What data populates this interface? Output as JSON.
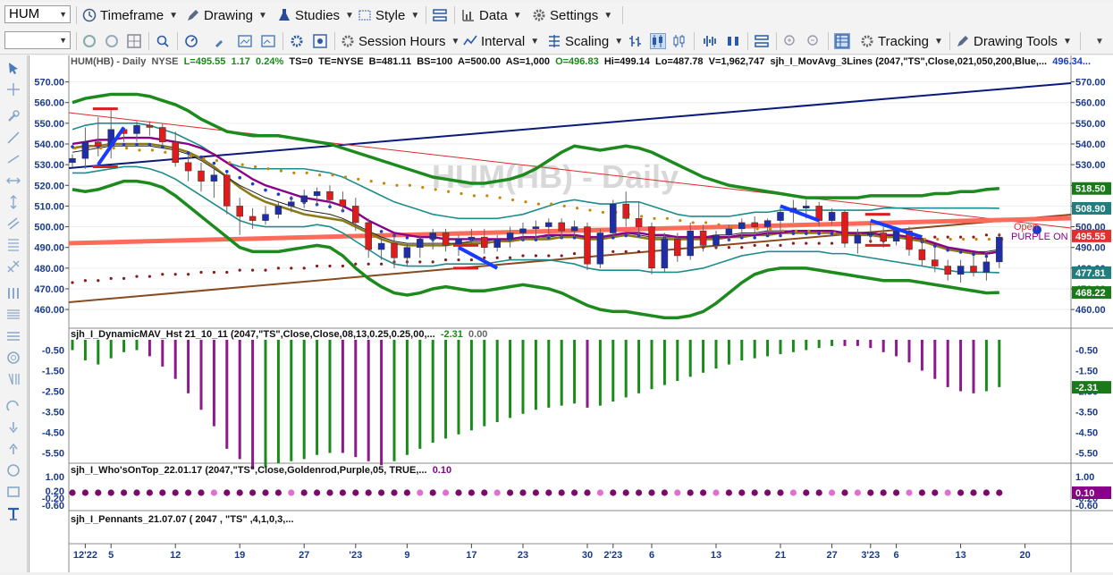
{
  "symbol": "HUM",
  "toolbar1": {
    "timeframe": "Timeframe",
    "drawing": "Drawing",
    "studies": "Studies",
    "style": "Style",
    "data": "Data",
    "settings": "Settings"
  },
  "toolbar2": {
    "session_hours": "Session Hours",
    "interval": "Interval",
    "scaling": "Scaling",
    "tracking": "Tracking",
    "drawing_tools": "Drawing Tools"
  },
  "header": {
    "symbol_label": "HUM(HB) - Daily",
    "exchange": "NYSE",
    "last": "L=495.55",
    "change": "1.17",
    "change_pct": "0.24%",
    "ts": "TS=0",
    "te": "TE=NYSE",
    "bid": "B=481.11",
    "bs": "BS=100",
    "ask": "A=500.00",
    "as": "AS=1,000",
    "open": "O=496.83",
    "hi": "Hi=499.14",
    "lo": "Lo=487.78",
    "vol": "V=1,962,747",
    "study": "sjh_I_MovAvg_3Lines (2047,\"TS\",Close,021,050,200,Blue,...",
    "study_value": "496.34..."
  },
  "watermark": "HUM(HB) - Daily",
  "annotations": {
    "open_label": "Open",
    "purple_on": "PURPLE ON"
  },
  "price_axis": {
    "ticks": [
      "570.00",
      "560.00",
      "550.00",
      "540.00",
      "530.00",
      "520.00",
      "510.00",
      "500.00",
      "490.00",
      "480.00",
      "470.00",
      "460.00"
    ],
    "tick_values": [
      570,
      560,
      550,
      540,
      530,
      520,
      510,
      500,
      490,
      480,
      470,
      460
    ],
    "badges": [
      {
        "text": "518.50",
        "color": "#1a7a1a",
        "value": 518.5
      },
      {
        "text": "508.90",
        "color": "#1f7f7f",
        "value": 508.9
      },
      {
        "text": "495.55",
        "color": "#e03030",
        "value": 495.55
      },
      {
        "text": "477.81",
        "color": "#1f7f7f",
        "value": 477.81
      },
      {
        "text": "468.22",
        "color": "#1a7a1a",
        "value": 468.22
      }
    ]
  },
  "pane2": {
    "title": "sjh_I_DynamicMAV_Hst 21_10_11 (2047,\"TS\",Close,Close,08,13,0.25,0.25,00,...",
    "val1": "-2.31",
    "val2": "0.00",
    "ticks": [
      "-0.50",
      "-1.50",
      "-2.50",
      "-3.50",
      "-4.50",
      "-5.50"
    ],
    "tick_values": [
      -0.5,
      -1.5,
      -2.5,
      -3.5,
      -4.5,
      -5.5
    ],
    "badge": "-2.31",
    "badge_value": -2.31
  },
  "pane3": {
    "title": "sjh_I_Who'sOnTop_22.01.17 (2047,\"TS\",Close,Goldenrod,Purple,05, TRUE,...",
    "val": "0.10",
    "ticks": [
      "1.00",
      "0.20",
      "-0.20",
      "-0.60"
    ],
    "tick_values": [
      1.0,
      0.2,
      -0.2,
      -0.6
    ],
    "badge": "0.10",
    "badge_value": 0.1
  },
  "pane4": {
    "title": "sjh_I_Pennants_21.07.07 ( 2047 , \"TS\" ,4,1,0,3,..."
  },
  "date_axis": [
    {
      "label": "12'22",
      "bar": 1
    },
    {
      "label": "5",
      "bar": 3
    },
    {
      "label": "12",
      "bar": 8
    },
    {
      "label": "19",
      "bar": 13
    },
    {
      "label": "27",
      "bar": 18
    },
    {
      "label": "'23",
      "bar": 22
    },
    {
      "label": "9",
      "bar": 26
    },
    {
      "label": "17",
      "bar": 31
    },
    {
      "label": "23",
      "bar": 35
    },
    {
      "label": "30",
      "bar": 40
    },
    {
      "label": "2'23",
      "bar": 42
    },
    {
      "label": "6",
      "bar": 45
    },
    {
      "label": "13",
      "bar": 50
    },
    {
      "label": "21",
      "bar": 55
    },
    {
      "label": "27",
      "bar": 59
    },
    {
      "label": "3'23",
      "bar": 62
    },
    {
      "label": "6",
      "bar": 64
    },
    {
      "label": "13",
      "bar": 69
    },
    {
      "label": "20",
      "bar": 74
    }
  ],
  "chart_data": {
    "type": "candlestick",
    "ylim": [
      454,
      575
    ],
    "candles": [
      [
        531,
        535,
        529,
        533
      ],
      [
        533,
        548,
        528,
        541
      ],
      [
        541,
        553,
        534,
        539
      ],
      [
        539,
        557,
        533,
        547
      ],
      [
        547,
        548,
        541,
        545
      ],
      [
        545,
        551,
        541,
        549
      ],
      [
        549,
        551,
        544,
        548
      ],
      [
        548,
        550,
        539,
        541
      ],
      [
        541,
        546,
        529,
        531
      ],
      [
        531,
        535,
        522,
        527
      ],
      [
        527,
        531,
        517,
        522
      ],
      [
        522,
        529,
        514,
        525
      ],
      [
        525,
        526,
        506,
        510
      ],
      [
        510,
        514,
        496,
        505
      ],
      [
        505,
        509,
        499,
        503
      ],
      [
        503,
        510,
        501,
        506
      ],
      [
        506,
        512,
        504,
        510
      ],
      [
        510,
        515,
        507,
        512
      ],
      [
        512,
        518,
        509,
        515
      ],
      [
        515,
        519,
        510,
        517
      ],
      [
        517,
        520,
        510,
        513
      ],
      [
        513,
        517,
        507,
        510
      ],
      [
        510,
        514,
        498,
        502
      ],
      [
        502,
        504,
        485,
        489
      ],
      [
        489,
        495,
        484,
        492
      ],
      [
        492,
        496,
        480,
        485
      ],
      [
        485,
        492,
        481,
        490
      ],
      [
        490,
        496,
        485,
        494
      ],
      [
        494,
        499,
        489,
        497
      ],
      [
        497,
        499,
        488,
        491
      ],
      [
        491,
        496,
        486,
        494
      ],
      [
        494,
        499,
        491,
        495
      ],
      [
        495,
        499,
        487,
        490
      ],
      [
        490,
        496,
        488,
        494
      ],
      [
        494,
        500,
        490,
        497
      ],
      [
        497,
        502,
        493,
        499
      ],
      [
        499,
        503,
        494,
        500
      ],
      [
        500,
        504,
        495,
        502
      ],
      [
        502,
        504,
        494,
        498
      ],
      [
        498,
        503,
        495,
        500
      ],
      [
        500,
        502,
        479,
        482
      ],
      [
        482,
        499,
        480,
        497
      ],
      [
        497,
        513,
        495,
        511
      ],
      [
        511,
        517,
        500,
        504
      ],
      [
        504,
        512,
        496,
        500
      ],
      [
        500,
        502,
        477,
        480
      ],
      [
        480,
        497,
        478,
        494
      ],
      [
        494,
        497,
        483,
        486
      ],
      [
        486,
        502,
        484,
        498
      ],
      [
        498,
        501,
        488,
        491
      ],
      [
        491,
        498,
        489,
        496
      ],
      [
        496,
        501,
        493,
        499
      ],
      [
        499,
        504,
        495,
        502
      ],
      [
        502,
        505,
        497,
        500
      ],
      [
        500,
        504,
        496,
        503
      ],
      [
        503,
        510,
        498,
        507
      ],
      [
        507,
        513,
        502,
        509
      ],
      [
        509,
        513,
        504,
        510
      ],
      [
        510,
        512,
        500,
        503
      ],
      [
        503,
        509,
        501,
        507
      ],
      [
        507,
        508,
        490,
        492
      ],
      [
        492,
        499,
        487,
        496
      ],
      [
        496,
        502,
        492,
        497
      ],
      [
        497,
        500,
        490,
        493
      ],
      [
        493,
        500,
        491,
        498
      ],
      [
        498,
        500,
        486,
        489
      ],
      [
        489,
        494,
        481,
        484
      ],
      [
        484,
        490,
        478,
        481
      ],
      [
        481,
        484,
        474,
        477
      ],
      [
        477,
        484,
        473,
        481
      ],
      [
        481,
        486,
        476,
        478
      ],
      [
        478,
        485,
        474,
        483
      ],
      [
        483,
        497,
        480,
        495
      ]
    ],
    "ma_purple": [
      540,
      541,
      542,
      542,
      543,
      543,
      543,
      542,
      541,
      540,
      538,
      535,
      531,
      527,
      523,
      520,
      518,
      516,
      514,
      513,
      512,
      510,
      507,
      503,
      500,
      497,
      496,
      495,
      495,
      494,
      494,
      494,
      494,
      494,
      494,
      495,
      495,
      496,
      496,
      496,
      495,
      495,
      496,
      497,
      497,
      496,
      496,
      495,
      495,
      495,
      495,
      495,
      496,
      496,
      497,
      497,
      498,
      498,
      498,
      498,
      497,
      497,
      497,
      496,
      496,
      495,
      494,
      492,
      490,
      489,
      488,
      487,
      488
    ],
    "ma_olive": [
      538,
      539,
      539,
      540,
      540,
      540,
      540,
      539,
      538,
      536,
      533,
      529,
      524,
      519,
      515,
      512,
      510,
      508,
      506,
      505,
      504,
      503,
      500,
      497,
      494,
      492,
      491,
      491,
      491,
      491,
      492,
      492,
      492,
      493,
      493,
      494,
      494,
      494,
      495,
      495,
      494,
      494,
      495,
      496,
      495,
      494,
      494,
      494,
      494,
      494,
      494,
      495,
      495,
      496,
      496,
      497,
      497,
      497,
      497,
      497,
      496,
      496,
      496,
      495,
      495,
      494,
      493,
      491,
      489,
      488,
      487,
      487,
      488
    ],
    "ma_black": [
      536,
      537,
      538,
      539,
      539,
      539,
      539,
      538,
      537,
      535,
      532,
      528,
      524,
      520,
      517,
      514,
      512,
      510,
      508,
      507,
      506,
      504,
      501,
      498,
      495,
      493,
      492,
      492,
      492,
      492,
      492,
      493,
      493,
      494,
      494,
      495,
      495,
      495,
      496,
      496,
      495,
      495,
      496,
      497,
      496,
      495,
      495,
      495,
      495,
      495,
      496,
      496,
      497,
      497,
      498,
      498,
      498,
      498,
      498,
      498,
      497,
      497,
      497,
      496,
      496,
      495,
      494,
      492,
      490,
      489,
      488,
      488,
      489
    ],
    "bb_upper": [
      560,
      562,
      563,
      564,
      564,
      564,
      563,
      561,
      559,
      556,
      552,
      549,
      546,
      545,
      544,
      544,
      544,
      543,
      542,
      541,
      540,
      538,
      536,
      534,
      532,
      530,
      528,
      526,
      524,
      523,
      522,
      521,
      521,
      522,
      523,
      525,
      528,
      532,
      536,
      539,
      538,
      537,
      538,
      539,
      538,
      536,
      533,
      530,
      527,
      524,
      522,
      520,
      519,
      518,
      517,
      516,
      515,
      514,
      514,
      514,
      514,
      514,
      515,
      515,
      515,
      515,
      515,
      516,
      516,
      517,
      517,
      518,
      518.5
    ],
    "bb_lower": [
      518,
      517,
      518,
      520,
      522,
      522,
      521,
      519,
      515,
      510,
      505,
      500,
      495,
      490,
      488,
      488,
      488,
      489,
      490,
      491,
      490,
      486,
      480,
      475,
      471,
      468,
      467,
      468,
      470,
      471,
      470,
      469,
      469,
      470,
      471,
      472,
      471,
      470,
      468,
      465,
      462,
      460,
      459,
      459,
      458,
      457,
      456,
      456,
      457,
      459,
      463,
      468,
      473,
      477,
      479,
      480,
      480,
      480,
      479,
      478,
      477,
      476,
      475,
      474,
      474,
      474,
      473,
      472,
      471,
      470,
      469,
      468,
      468.2
    ],
    "kc_upper": [
      547,
      549,
      550,
      550,
      550,
      550,
      549,
      547,
      545,
      542,
      539,
      535,
      531,
      529,
      528,
      528,
      528,
      528,
      528,
      527,
      526,
      524,
      521,
      518,
      515,
      512,
      510,
      508,
      506,
      505,
      504,
      504,
      504,
      504,
      505,
      506,
      508,
      510,
      512,
      513,
      512,
      511,
      511,
      512,
      512,
      510,
      508,
      506,
      505,
      505,
      505,
      505,
      506,
      507,
      507,
      508,
      508,
      508,
      508,
      508,
      508,
      508,
      508,
      509,
      509,
      509,
      509,
      509,
      509,
      509,
      509,
      509,
      508.9
    ],
    "kc_lower": [
      526,
      526,
      527,
      528,
      529,
      529,
      528,
      526,
      523,
      519,
      515,
      511,
      507,
      503,
      501,
      500,
      500,
      500,
      500,
      501,
      500,
      497,
      493,
      489,
      485,
      482,
      481,
      481,
      481,
      482,
      482,
      482,
      482,
      483,
      484,
      484,
      484,
      484,
      483,
      482,
      480,
      479,
      479,
      479,
      479,
      478,
      478,
      478,
      479,
      480,
      482,
      484,
      486,
      487,
      488,
      488,
      488,
      488,
      488,
      487,
      487,
      486,
      485,
      484,
      483,
      482,
      481,
      480,
      479,
      478,
      478,
      478,
      477.8
    ],
    "dots_gold": [
      538,
      538,
      538,
      538,
      538,
      537,
      537,
      536,
      535,
      534,
      533,
      532,
      531,
      530,
      529,
      528,
      527,
      526,
      526,
      525,
      525,
      524,
      523,
      522,
      521,
      520,
      520,
      519,
      518,
      517,
      516,
      515,
      515,
      514,
      513,
      512,
      511,
      511,
      510,
      509,
      508,
      507,
      507,
      506,
      505,
      504,
      504,
      503,
      502,
      502,
      501,
      500,
      500,
      499,
      499,
      498,
      498,
      498,
      497,
      497,
      496,
      496,
      496,
      495,
      495,
      495,
      494,
      494,
      494,
      494,
      494,
      494,
      494
    ],
    "dots_blue": [
      540,
      540,
      540,
      541,
      541,
      541,
      541,
      540,
      539,
      537,
      535,
      532,
      528,
      525,
      522,
      519,
      517,
      515,
      513,
      512,
      511,
      509,
      506,
      502,
      499,
      497,
      496,
      495,
      495,
      495,
      495,
      495,
      494,
      494,
      495,
      495,
      495,
      496,
      496,
      496,
      495,
      495,
      496,
      497,
      497,
      496,
      496,
      495,
      495,
      495,
      495,
      495,
      496,
      496,
      497,
      497,
      498,
      498,
      498,
      498,
      497,
      497,
      497,
      496,
      496,
      495,
      494,
      492,
      490,
      489,
      488,
      487,
      488
    ],
    "dots_maroon": [
      473,
      474,
      474,
      475,
      475,
      476,
      476,
      477,
      477,
      477,
      478,
      478,
      478,
      479,
      479,
      479,
      480,
      480,
      480,
      481,
      481,
      481,
      482,
      482,
      482,
      483,
      483,
      483,
      483,
      484,
      484,
      484,
      485,
      485,
      485,
      486,
      486,
      486,
      486,
      487,
      487,
      487,
      488,
      488,
      488,
      488,
      489,
      489,
      489,
      490,
      490,
      490,
      490,
      491,
      491,
      491,
      492,
      492,
      492,
      492,
      493,
      493,
      493,
      493,
      494,
      494,
      494,
      495,
      495,
      495,
      495,
      496,
      496
    ],
    "histogram": [
      -0.5,
      -1.0,
      -1.2,
      -0.9,
      -0.6,
      -0.5,
      -0.8,
      -1.3,
      -1.9,
      -2.6,
      -3.4,
      -4.2,
      -5.3,
      -5.8,
      -6.3,
      -6.2,
      -6.0,
      -5.9,
      -5.8,
      -5.6,
      -5.5,
      -5.5,
      -5.7,
      -5.9,
      -6.1,
      -5.9,
      -5.6,
      -5.3,
      -5.0,
      -4.8,
      -4.6,
      -4.4,
      -4.2,
      -4.0,
      -3.8,
      -3.6,
      -3.4,
      -3.3,
      -3.2,
      -3.1,
      -3.3,
      -3.2,
      -3.0,
      -2.8,
      -2.6,
      -2.4,
      -2.2,
      -2.0,
      -1.8,
      -1.6,
      -1.4,
      -1.2,
      -1.0,
      -0.9,
      -0.8,
      -0.7,
      -0.6,
      -0.5,
      -0.4,
      -0.3,
      -0.3,
      -0.3,
      -0.4,
      -0.6,
      -0.8,
      -1.1,
      -1.5,
      -1.9,
      -2.3,
      -2.5,
      -2.6,
      -2.5,
      -2.3
    ],
    "hist_colors": [
      "g",
      "g",
      "g",
      "g",
      "g",
      "g",
      "p",
      "p",
      "p",
      "p",
      "p",
      "p",
      "p",
      "p",
      "p",
      "g",
      "g",
      "g",
      "g",
      "g",
      "g",
      "p",
      "p",
      "p",
      "p",
      "g",
      "g",
      "g",
      "g",
      "g",
      "g",
      "g",
      "g",
      "g",
      "g",
      "g",
      "g",
      "g",
      "g",
      "g",
      "p",
      "g",
      "g",
      "g",
      "g",
      "g",
      "g",
      "g",
      "g",
      "g",
      "g",
      "g",
      "g",
      "g",
      "g",
      "g",
      "g",
      "g",
      "g",
      "g",
      "p",
      "p",
      "p",
      "p",
      "p",
      "p",
      "p",
      "p",
      "p",
      "p",
      "p",
      "g",
      "g"
    ],
    "wot_colors": [
      "p",
      "p",
      "p",
      "p",
      "p",
      "p",
      "p",
      "p",
      "p",
      "p",
      "p",
      "k",
      "p",
      "p",
      "p",
      "p",
      "p",
      "k",
      "p",
      "p",
      "p",
      "p",
      "p",
      "p",
      "p",
      "p",
      "p",
      "k",
      "p",
      "k",
      "p",
      "p",
      "p",
      "k",
      "p",
      "p",
      "p",
      "p",
      "p",
      "p",
      "p",
      "k",
      "p",
      "p",
      "p",
      "p",
      "p",
      "k",
      "p",
      "p",
      "k",
      "p",
      "p",
      "p",
      "p",
      "p",
      "k",
      "p",
      "p",
      "k",
      "p",
      "k",
      "p",
      "p",
      "p",
      "k",
      "p",
      "p",
      "k",
      "p",
      "p",
      "p",
      "p"
    ]
  },
  "colors": {
    "up_candle": "#1e2ea8",
    "down_candle": "#e01b1b",
    "green_band": "#1c8a1c",
    "teal_band": "#1e8c8c",
    "purple_ma": "#8b008b",
    "olive_ma": "#8a7a18",
    "hist_green": "#1a8a1a",
    "hist_purple": "#8b1a8b"
  }
}
